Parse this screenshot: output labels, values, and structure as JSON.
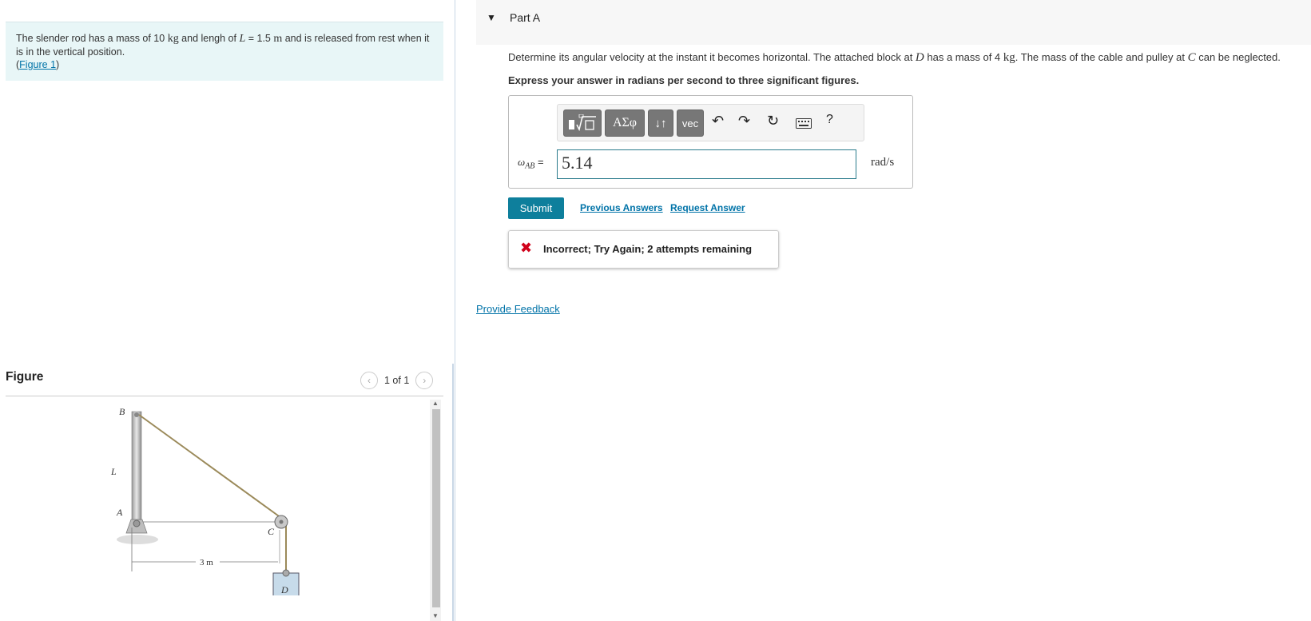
{
  "problem": {
    "text_before_mass": "The slender rod has a mass of 10 ",
    "mass_unit": "kg",
    "text_before_L": " and lengh of ",
    "L_symbol": "L",
    "text_L_value": " = 1.5 ",
    "length_unit": "m",
    "text_after": " and is released from rest when it is in the vertical position.",
    "figure_link_open": "(",
    "figure_link": "Figure 1",
    "figure_link_close": ")"
  },
  "figure": {
    "title": "Figure",
    "pager": "1 of 1",
    "prev_icon": "chevron-left-icon",
    "next_icon": "chevron-right-icon",
    "labels": {
      "B": "B",
      "L": "L",
      "A": "A",
      "C": "C",
      "D": "D",
      "dist": "3 m"
    }
  },
  "part": {
    "title": "Part A",
    "caret_icon": "caret-down-icon"
  },
  "question": {
    "p1": "Determine its angular velocity at the instant it becomes horizontal. The attached block at ",
    "D": "D",
    "p2": " has a mass of 4 ",
    "kg": "kg",
    "p3": ". The mass of the cable and pulley at ",
    "C": "C",
    "p4": " can be neglected.",
    "instruction": "Express your answer in radians per second to three significant figures."
  },
  "toolbar": {
    "templates_icon": "templates-icon",
    "greek": "ΑΣφ",
    "arrows": "↓↑",
    "vec": "vec",
    "undo_icon": "undo-icon",
    "redo_icon": "redo-icon",
    "reset_icon": "reset-icon",
    "keyboard_icon": "keyboard-icon",
    "help": "?"
  },
  "answer": {
    "label_omega": "ω",
    "label_sub": "AB",
    "label_eq": " =",
    "value": "5.14",
    "unit": "rad/s"
  },
  "actions": {
    "submit": "Submit",
    "previous_answers": "Previous Answers",
    "request_answer": "Request Answer"
  },
  "feedback": {
    "icon": "x-icon",
    "text": "Incorrect; Try Again; 2 attempts remaining",
    "color": "#d0021b"
  },
  "provide_feedback": "Provide Feedback",
  "colors": {
    "accent": "#0e7f9c",
    "link": "#0073a8",
    "problem_bg": "#e8f6f7"
  }
}
